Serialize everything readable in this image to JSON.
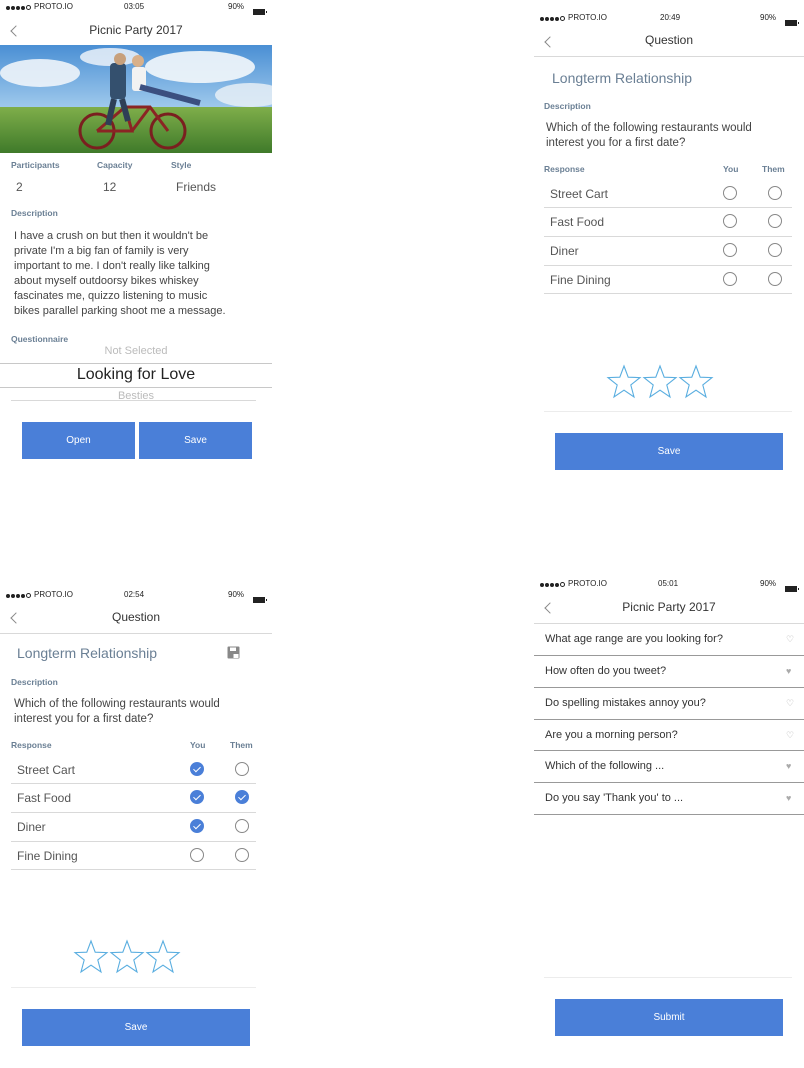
{
  "screen1": {
    "status": {
      "carrier": "PROTO.IO",
      "time": "03:05",
      "battery": "90%"
    },
    "nav_title": "Picnic Party 2017",
    "fields": {
      "participants_label": "Participants",
      "participants_value": "2",
      "capacity_label": "Capacity",
      "capacity_value": "12",
      "style_label": "Style",
      "style_value": "Friends"
    },
    "description_label": "Description",
    "description_lines": [
      "I have a crush on but then it wouldn't be",
      "private I'm a big fan of family is very",
      "important to me. I don't really like talking",
      "about myself outdoorsy bikes whiskey",
      "fascinates me, quizzo listening to music",
      "bikes parallel parking shoot me a message."
    ],
    "questionnaire_label": "Questionnaire",
    "picker": {
      "above": "Not Selected",
      "selected": "Looking for Love",
      "below": "Besties"
    },
    "open_label": "Open",
    "save_label": "Save"
  },
  "screen2": {
    "status": {
      "carrier": "PROTO.IO",
      "time": "20:49",
      "battery": "90%"
    },
    "nav_title": "Question",
    "section_title": "Longterm Relationship",
    "description_label": "Description",
    "question_lines": [
      "Which of the following restaurants would",
      "interest you for a first date?"
    ],
    "response_label": "Response",
    "you_label": "You",
    "them_label": "Them",
    "options": [
      "Street Cart",
      "Fast Food",
      "Diner",
      "Fine Dining"
    ],
    "you_checked": [
      false,
      false,
      false,
      false
    ],
    "them_checked": [
      false,
      false,
      false,
      false
    ],
    "rating": {
      "stars": 3,
      "filled": 0,
      "color": "#5aaee0"
    },
    "save_label": "Save"
  },
  "screen3": {
    "status": {
      "carrier": "PROTO.IO",
      "time": "02:54",
      "battery": "90%"
    },
    "nav_title": "Question",
    "section_title": "Longterm Relationship",
    "description_label": "Description",
    "question_lines": [
      "Which of the following restaurants would",
      "interest you for a first date?"
    ],
    "response_label": "Response",
    "you_label": "You",
    "them_label": "Them",
    "options": [
      "Street Cart",
      "Fast Food",
      "Diner",
      "Fine Dining"
    ],
    "you_checked": [
      true,
      true,
      true,
      false
    ],
    "them_checked": [
      false,
      true,
      false,
      false
    ],
    "rating": {
      "stars": 3,
      "filled": 0,
      "color": "#5aaee0"
    },
    "save_label": "Save"
  },
  "screen4": {
    "status": {
      "carrier": "PROTO.IO",
      "time": "05:01",
      "battery": "90%"
    },
    "nav_title": "Picnic Party 2017",
    "questions": [
      {
        "text": "What age range are you looking for?",
        "answered": false
      },
      {
        "text": "How often do you tweet?",
        "answered": true
      },
      {
        "text": "Do spelling mistakes annoy you?",
        "answered": false
      },
      {
        "text": "Are you a morning person?",
        "answered": false
      },
      {
        "text": "Which of the following ...",
        "answered": true
      },
      {
        "text": "Do you say 'Thank you' to ...",
        "answered": true
      }
    ],
    "submit_label": "Submit"
  },
  "colors": {
    "accent": "#4a7fd8",
    "label": "#6a7f94",
    "divider": "#d9d9d9"
  }
}
